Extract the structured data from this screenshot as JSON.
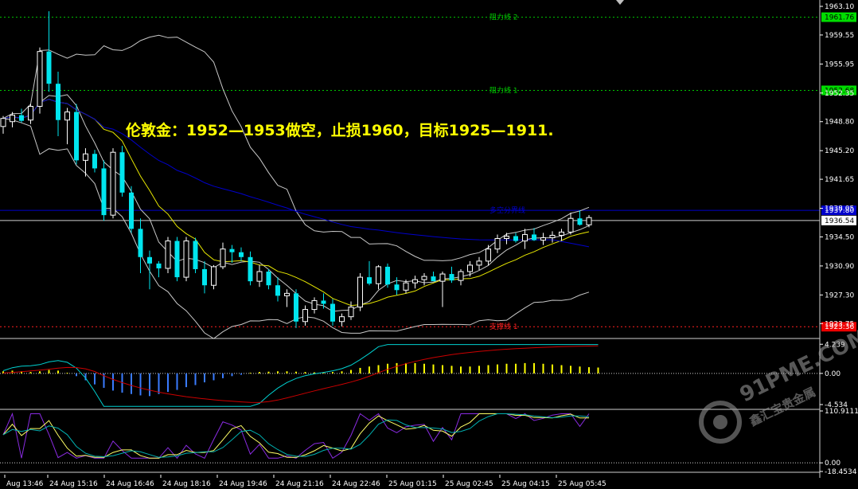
{
  "annotation": "伦敦金：1952—1953做空，止损1960，目标1925—1911.",
  "watermark": {
    "brand": "91PME.COM",
    "cn": "鑫汇宝贵金属"
  },
  "colors": {
    "background": "#000000",
    "bull_candle": "#000000",
    "bear_candle": "#00e5ee",
    "resistance": "#00c800",
    "support": "#ff2020",
    "ma200": "#0000cc",
    "bands": "#c8c8c8",
    "ma_yellow": "#e8e800",
    "macd_hist_pos": "#ffff00",
    "macd_hist_neg": "#3a7bff",
    "macd_fast": "#00d0d0",
    "macd_slow": "#cc0000",
    "osc_purple": "#8a2be2",
    "osc_yellow": "#ffff66",
    "osc_cyan": "#00b0b0"
  },
  "chart_data": [
    {
      "type": "candlestick",
      "symbol": "XAUUSD",
      "ylim": [
        1922.0,
        1963.1
      ],
      "y_ticks": [
        "1963.10",
        "1959.55",
        "1955.95",
        "1952.35",
        "1948.80",
        "1945.20",
        "1941.65",
        "1938.05",
        "1934.50",
        "1930.90",
        "1927.30",
        "1923.75"
      ],
      "x_ticks": [
        "Aug 13:46",
        "24 Aug 15:16",
        "24 Aug 16:46",
        "24 Aug 18:16",
        "24 Aug 19:46",
        "24 Aug 21:16",
        "24 Aug 22:46",
        "25 Aug 01:15",
        "25 Aug 02:45",
        "25 Aug 04:15",
        "25 Aug 05:45"
      ],
      "levels": [
        {
          "name": "阻力线 2",
          "value": 1961.76,
          "tag": "1961.76",
          "kind": "resistance"
        },
        {
          "name": "阻力线 1",
          "value": 1952.68,
          "tag": "1952.68",
          "kind": "resistance"
        },
        {
          "name": "多空分界线",
          "value": 1937.8,
          "tag": "1937.80",
          "kind": "pivot"
        },
        {
          "name": "支撑线 1",
          "value": 1923.36,
          "tag": "1923.36",
          "kind": "support"
        }
      ],
      "current_price": "1936.54",
      "candles": [
        [
          1948.2,
          1949.5,
          1947.3,
          1949.2
        ],
        [
          1948.8,
          1950.0,
          1948.1,
          1949.6
        ],
        [
          1949.6,
          1950.4,
          1948.7,
          1948.9
        ],
        [
          1949.0,
          1951.0,
          1948.5,
          1950.7
        ],
        [
          1950.7,
          1958.0,
          1949.8,
          1957.5
        ],
        [
          1957.5,
          1962.5,
          1952.5,
          1953.5
        ],
        [
          1953.5,
          1955.0,
          1947.0,
          1949.0
        ],
        [
          1949.0,
          1950.5,
          1946.0,
          1950.0
        ],
        [
          1950.0,
          1951.0,
          1943.5,
          1944.0
        ],
        [
          1944.0,
          1945.5,
          1942.0,
          1944.8
        ],
        [
          1944.8,
          1945.3,
          1942.5,
          1943.0
        ],
        [
          1943.0,
          1944.0,
          1936.5,
          1937.2
        ],
        [
          1937.2,
          1945.5,
          1936.8,
          1945.0
        ],
        [
          1945.0,
          1945.8,
          1939.5,
          1940.0
        ],
        [
          1940.0,
          1940.8,
          1935.0,
          1935.5
        ],
        [
          1935.5,
          1936.8,
          1930.0,
          1932.0
        ],
        [
          1932.0,
          1932.8,
          1928.0,
          1931.2
        ],
        [
          1931.2,
          1931.5,
          1929.5,
          1930.6
        ],
        [
          1930.6,
          1934.5,
          1930.0,
          1934.0
        ],
        [
          1934.0,
          1934.5,
          1929.0,
          1929.5
        ],
        [
          1929.5,
          1934.5,
          1929.0,
          1934.0
        ],
        [
          1934.0,
          1934.4,
          1930.0,
          1930.5
        ],
        [
          1930.5,
          1931.5,
          1927.5,
          1928.5
        ],
        [
          1928.5,
          1931.0,
          1928.0,
          1930.8
        ],
        [
          1930.8,
          1933.8,
          1930.5,
          1933.0
        ],
        [
          1933.0,
          1933.5,
          1931.3,
          1932.6
        ],
        [
          1932.6,
          1933.2,
          1931.5,
          1932.0
        ],
        [
          1932.0,
          1932.7,
          1928.5,
          1929.0
        ],
        [
          1929.0,
          1931.0,
          1928.3,
          1930.2
        ],
        [
          1930.2,
          1930.5,
          1928.0,
          1928.5
        ],
        [
          1928.5,
          1929.5,
          1926.5,
          1927.2
        ],
        [
          1927.2,
          1928.0,
          1925.8,
          1927.5
        ],
        [
          1927.5,
          1928.0,
          1923.2,
          1924.0
        ],
        [
          1924.0,
          1926.0,
          1923.5,
          1925.5
        ],
        [
          1925.5,
          1927.0,
          1925.0,
          1926.6
        ],
        [
          1926.6,
          1927.5,
          1925.6,
          1926.2
        ],
        [
          1926.2,
          1926.8,
          1923.5,
          1924.0
        ],
        [
          1924.0,
          1925.0,
          1923.4,
          1924.6
        ],
        [
          1924.6,
          1926.5,
          1924.2,
          1925.8
        ],
        [
          1925.8,
          1930.0,
          1925.3,
          1929.5
        ],
        [
          1929.5,
          1931.5,
          1928.5,
          1928.7
        ],
        [
          1928.7,
          1931.0,
          1928.0,
          1930.8
        ],
        [
          1930.8,
          1931.2,
          1928.2,
          1928.6
        ],
        [
          1928.6,
          1929.5,
          1927.3,
          1927.9
        ],
        [
          1927.9,
          1929.2,
          1927.5,
          1928.8
        ],
        [
          1928.8,
          1929.7,
          1928.1,
          1929.2
        ],
        [
          1929.2,
          1930.0,
          1928.5,
          1929.6
        ],
        [
          1929.6,
          1930.2,
          1929.0,
          1929.0
        ],
        [
          1929.0,
          1930.2,
          1925.8,
          1929.9
        ],
        [
          1929.9,
          1930.8,
          1928.8,
          1929.1
        ],
        [
          1929.1,
          1930.5,
          1928.5,
          1930.2
        ],
        [
          1930.2,
          1931.5,
          1929.6,
          1931.0
        ],
        [
          1931.0,
          1932.0,
          1930.4,
          1931.5
        ],
        [
          1931.5,
          1933.5,
          1931.0,
          1933.0
        ],
        [
          1933.0,
          1934.8,
          1932.5,
          1934.3
        ],
        [
          1934.3,
          1935.0,
          1933.6,
          1934.6
        ],
        [
          1934.6,
          1935.0,
          1933.8,
          1934.0
        ],
        [
          1934.0,
          1935.5,
          1933.0,
          1934.8
        ],
        [
          1934.8,
          1935.6,
          1934.0,
          1934.1
        ],
        [
          1934.1,
          1935.0,
          1933.5,
          1934.4
        ],
        [
          1934.4,
          1935.2,
          1933.8,
          1934.7
        ],
        [
          1934.7,
          1935.5,
          1934.0,
          1935.1
        ],
        [
          1935.1,
          1937.5,
          1934.8,
          1936.8
        ],
        [
          1936.8,
          1937.8,
          1935.9,
          1936.0
        ],
        [
          1936.0,
          1937.2,
          1935.7,
          1936.9
        ]
      ]
    },
    {
      "type": "histogram",
      "name": "MACD",
      "y_ticks": [
        "4.239",
        "0.00",
        "-4.534"
      ],
      "ylim": [
        -5.0,
        4.5
      ],
      "values": [
        0.3,
        0.4,
        0.3,
        0.2,
        0.3,
        0.5,
        0.4,
        0.1,
        -0.4,
        -1.0,
        -1.6,
        -2.1,
        -2.5,
        -2.8,
        -3.0,
        -3.2,
        -3.3,
        -3.0,
        -2.7,
        -2.4,
        -2.0,
        -1.7,
        -1.3,
        -1.0,
        -0.7,
        -0.4,
        -0.2,
        0.1,
        0.2,
        0.25,
        0.3,
        0.3,
        0.25,
        0.2,
        0.15,
        0.15,
        0.2,
        0.3,
        0.5,
        0.8,
        1.0,
        1.2,
        1.4,
        1.5,
        1.5,
        1.5,
        1.4,
        1.3,
        1.2,
        1.1,
        1.0,
        1.0,
        1.1,
        1.2,
        1.3,
        1.4,
        1.4,
        1.5,
        1.5,
        1.4,
        1.3,
        1.2,
        1.1,
        1.0,
        0.9,
        0.85
      ]
    },
    {
      "type": "line",
      "name": "oscillator",
      "y_ticks": [
        "110.9111",
        "0.00",
        "-18.4534"
      ],
      "ylim": [
        -18.4534,
        110.9111
      ]
    }
  ]
}
